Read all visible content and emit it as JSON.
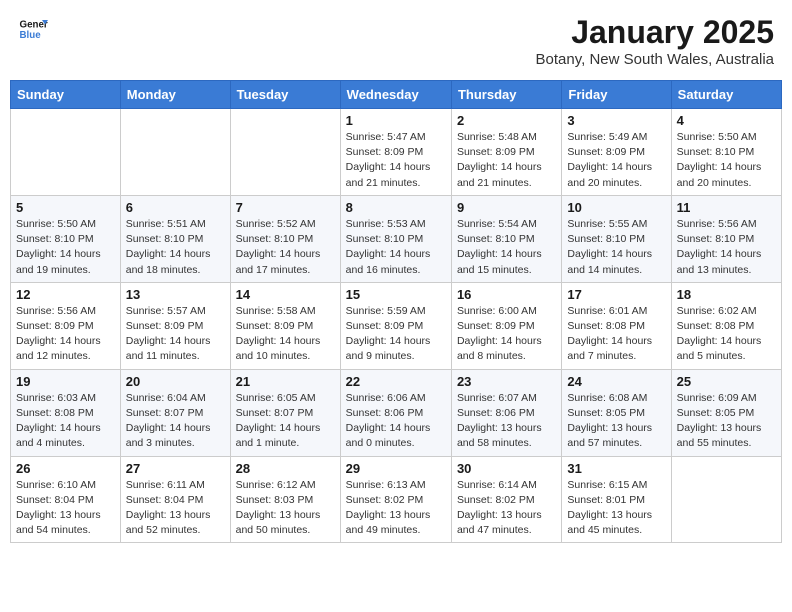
{
  "header": {
    "logo_line1": "General",
    "logo_line2": "Blue",
    "month": "January 2025",
    "location": "Botany, New South Wales, Australia"
  },
  "weekdays": [
    "Sunday",
    "Monday",
    "Tuesday",
    "Wednesday",
    "Thursday",
    "Friday",
    "Saturday"
  ],
  "weeks": [
    [
      {
        "day": "",
        "info": ""
      },
      {
        "day": "",
        "info": ""
      },
      {
        "day": "",
        "info": ""
      },
      {
        "day": "1",
        "info": "Sunrise: 5:47 AM\nSunset: 8:09 PM\nDaylight: 14 hours\nand 21 minutes."
      },
      {
        "day": "2",
        "info": "Sunrise: 5:48 AM\nSunset: 8:09 PM\nDaylight: 14 hours\nand 21 minutes."
      },
      {
        "day": "3",
        "info": "Sunrise: 5:49 AM\nSunset: 8:09 PM\nDaylight: 14 hours\nand 20 minutes."
      },
      {
        "day": "4",
        "info": "Sunrise: 5:50 AM\nSunset: 8:10 PM\nDaylight: 14 hours\nand 20 minutes."
      }
    ],
    [
      {
        "day": "5",
        "info": "Sunrise: 5:50 AM\nSunset: 8:10 PM\nDaylight: 14 hours\nand 19 minutes."
      },
      {
        "day": "6",
        "info": "Sunrise: 5:51 AM\nSunset: 8:10 PM\nDaylight: 14 hours\nand 18 minutes."
      },
      {
        "day": "7",
        "info": "Sunrise: 5:52 AM\nSunset: 8:10 PM\nDaylight: 14 hours\nand 17 minutes."
      },
      {
        "day": "8",
        "info": "Sunrise: 5:53 AM\nSunset: 8:10 PM\nDaylight: 14 hours\nand 16 minutes."
      },
      {
        "day": "9",
        "info": "Sunrise: 5:54 AM\nSunset: 8:10 PM\nDaylight: 14 hours\nand 15 minutes."
      },
      {
        "day": "10",
        "info": "Sunrise: 5:55 AM\nSunset: 8:10 PM\nDaylight: 14 hours\nand 14 minutes."
      },
      {
        "day": "11",
        "info": "Sunrise: 5:56 AM\nSunset: 8:10 PM\nDaylight: 14 hours\nand 13 minutes."
      }
    ],
    [
      {
        "day": "12",
        "info": "Sunrise: 5:56 AM\nSunset: 8:09 PM\nDaylight: 14 hours\nand 12 minutes."
      },
      {
        "day": "13",
        "info": "Sunrise: 5:57 AM\nSunset: 8:09 PM\nDaylight: 14 hours\nand 11 minutes."
      },
      {
        "day": "14",
        "info": "Sunrise: 5:58 AM\nSunset: 8:09 PM\nDaylight: 14 hours\nand 10 minutes."
      },
      {
        "day": "15",
        "info": "Sunrise: 5:59 AM\nSunset: 8:09 PM\nDaylight: 14 hours\nand 9 minutes."
      },
      {
        "day": "16",
        "info": "Sunrise: 6:00 AM\nSunset: 8:09 PM\nDaylight: 14 hours\nand 8 minutes."
      },
      {
        "day": "17",
        "info": "Sunrise: 6:01 AM\nSunset: 8:08 PM\nDaylight: 14 hours\nand 7 minutes."
      },
      {
        "day": "18",
        "info": "Sunrise: 6:02 AM\nSunset: 8:08 PM\nDaylight: 14 hours\nand 5 minutes."
      }
    ],
    [
      {
        "day": "19",
        "info": "Sunrise: 6:03 AM\nSunset: 8:08 PM\nDaylight: 14 hours\nand 4 minutes."
      },
      {
        "day": "20",
        "info": "Sunrise: 6:04 AM\nSunset: 8:07 PM\nDaylight: 14 hours\nand 3 minutes."
      },
      {
        "day": "21",
        "info": "Sunrise: 6:05 AM\nSunset: 8:07 PM\nDaylight: 14 hours\nand 1 minute."
      },
      {
        "day": "22",
        "info": "Sunrise: 6:06 AM\nSunset: 8:06 PM\nDaylight: 14 hours\nand 0 minutes."
      },
      {
        "day": "23",
        "info": "Sunrise: 6:07 AM\nSunset: 8:06 PM\nDaylight: 13 hours\nand 58 minutes."
      },
      {
        "day": "24",
        "info": "Sunrise: 6:08 AM\nSunset: 8:05 PM\nDaylight: 13 hours\nand 57 minutes."
      },
      {
        "day": "25",
        "info": "Sunrise: 6:09 AM\nSunset: 8:05 PM\nDaylight: 13 hours\nand 55 minutes."
      }
    ],
    [
      {
        "day": "26",
        "info": "Sunrise: 6:10 AM\nSunset: 8:04 PM\nDaylight: 13 hours\nand 54 minutes."
      },
      {
        "day": "27",
        "info": "Sunrise: 6:11 AM\nSunset: 8:04 PM\nDaylight: 13 hours\nand 52 minutes."
      },
      {
        "day": "28",
        "info": "Sunrise: 6:12 AM\nSunset: 8:03 PM\nDaylight: 13 hours\nand 50 minutes."
      },
      {
        "day": "29",
        "info": "Sunrise: 6:13 AM\nSunset: 8:02 PM\nDaylight: 13 hours\nand 49 minutes."
      },
      {
        "day": "30",
        "info": "Sunrise: 6:14 AM\nSunset: 8:02 PM\nDaylight: 13 hours\nand 47 minutes."
      },
      {
        "day": "31",
        "info": "Sunrise: 6:15 AM\nSunset: 8:01 PM\nDaylight: 13 hours\nand 45 minutes."
      },
      {
        "day": "",
        "info": ""
      }
    ]
  ]
}
